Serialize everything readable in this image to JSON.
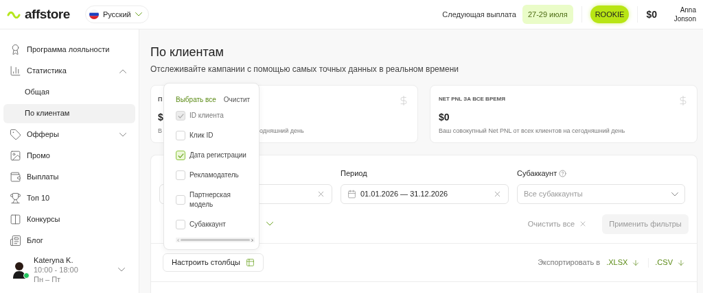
{
  "header": {
    "logo": "affstore",
    "language": "Русский",
    "next_payout_label": "Следующая выплата",
    "next_payout_dates": "27-29 июля",
    "level_badge": "ROOKIE",
    "balance": "$0",
    "user_name": "Anna Jonson"
  },
  "sidebar": {
    "items": [
      {
        "label": "Программа лояльности",
        "selected": false
      },
      {
        "label": "Статистика",
        "selected": false,
        "expanded": true,
        "children": [
          {
            "label": "Общая",
            "selected": false
          },
          {
            "label": "По клиентам",
            "selected": true
          }
        ]
      },
      {
        "label": "Офферы",
        "selected": false,
        "expanded": false
      },
      {
        "label": "Промо",
        "selected": false
      },
      {
        "label": "Выплаты",
        "selected": false
      },
      {
        "label": "Топ 10",
        "selected": false
      },
      {
        "label": "Конкурсы",
        "selected": false
      },
      {
        "label": "Блог",
        "selected": false
      }
    ],
    "manager": {
      "name": "Kateryna K.",
      "hours": "10:00 - 18:00",
      "days": "Пн – Пт",
      "online": true
    }
  },
  "page": {
    "title": "По клиентам",
    "subtitle": "Отслеживайте кампании с помощью самых точных данных в реальном времени"
  },
  "summary_cards": [
    {
      "title": "П",
      "value": "$",
      "description_fragments": [
        "В",
        "одняшний день"
      ]
    },
    {
      "title": "NET PNL ЗА ВСЕ ВРЕМЯ",
      "value": "$0",
      "description": "Ваш совокупный Net PNL от всех клиентов на сегодняшний день"
    }
  ],
  "filters": {
    "fields": [
      {
        "kind": "clearable"
      },
      {
        "kind": "date",
        "label": "Период",
        "value": "01.01.2026 — 31.12.2026"
      },
      {
        "kind": "select",
        "label": "Субаккаунт",
        "placeholder": "Все субаккаунты"
      }
    ],
    "clear_all": "Очистить все",
    "apply": "Применить фильтры",
    "apply_disabled": true
  },
  "columns_button": "Настроить столбцы",
  "export": {
    "label": "Экспортировать в",
    "formats": [
      ".XLSX",
      ".CSV"
    ]
  },
  "column_picker": {
    "select_all": "Выбрать все",
    "clear": "Очистит",
    "options": [
      {
        "label": "ID клиента",
        "checked": true,
        "disabled": true
      },
      {
        "label": "Клик ID",
        "checked": false,
        "disabled": false
      },
      {
        "label": "Дата регистрации",
        "checked": true,
        "disabled": false
      },
      {
        "label": "Рекламодатель",
        "checked": false,
        "disabled": false
      },
      {
        "label": "Партнерская модель",
        "checked": false,
        "disabled": false
      },
      {
        "label": "Субаккаунт",
        "checked": false,
        "disabled": false
      }
    ]
  }
}
